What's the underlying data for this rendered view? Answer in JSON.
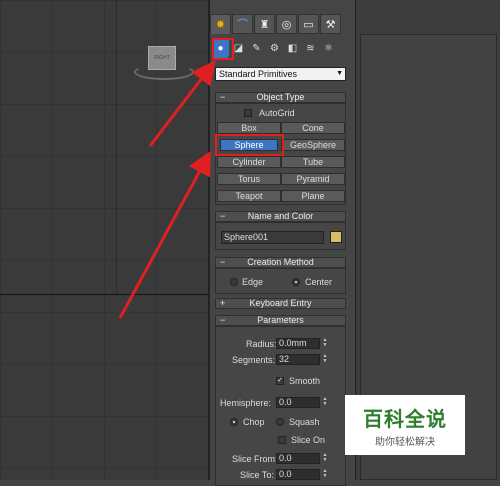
{
  "viewport": {
    "viewcube_label": "RIGHT"
  },
  "tabs": [
    {
      "icon": "create-icon",
      "glyph": "✸"
    },
    {
      "icon": "modify-icon",
      "glyph": "⌒"
    },
    {
      "icon": "hierarchy-icon",
      "glyph": "♜"
    },
    {
      "icon": "motion-icon",
      "glyph": "◎"
    },
    {
      "icon": "display-icon",
      "glyph": "▭"
    },
    {
      "icon": "utilities-icon",
      "glyph": "⚒"
    }
  ],
  "subtabs": [
    {
      "icon": "geometry-icon",
      "glyph": "●"
    },
    {
      "icon": "shapes-icon",
      "glyph": "◪"
    },
    {
      "icon": "lights-icon",
      "glyph": "✎"
    },
    {
      "icon": "cameras-icon",
      "glyph": "⚙"
    },
    {
      "icon": "helpers-icon",
      "glyph": "◧"
    },
    {
      "icon": "spacewarps-icon",
      "glyph": "≋"
    },
    {
      "icon": "systems-icon",
      "glyph": "⚛"
    }
  ],
  "category_dropdown": {
    "value": "Standard Primitives"
  },
  "object_type": {
    "title": "Object Type",
    "autogrid_label": "AutoGrid",
    "buttons": [
      "Box",
      "Cone",
      "Sphere",
      "GeoSphere",
      "Cylinder",
      "Tube",
      "Torus",
      "Pyramid",
      "Teapot",
      "Plane"
    ],
    "active": "Sphere"
  },
  "name_color": {
    "title": "Name and Color",
    "name_value": "Sphere001",
    "color": "#d8c060"
  },
  "creation_method": {
    "title": "Creation Method",
    "options": [
      "Edge",
      "Center"
    ],
    "selected": "Center"
  },
  "keyboard_entry": {
    "title": "Keyboard Entry"
  },
  "parameters": {
    "title": "Parameters",
    "radius_label": "Radius:",
    "radius_value": "0.0mm",
    "segments_label": "Segments:",
    "segments_value": "32",
    "smooth_label": "Smooth",
    "hemisphere_label": "Hemisphere:",
    "hemisphere_value": "0.0",
    "chop_label": "Chop",
    "squash_label": "Squash",
    "slice_on_label": "Slice On",
    "slice_from_label": "Slice From:",
    "slice_from_value": "0.0",
    "slice_to_label": "Slice To:",
    "slice_to_value": "0.0"
  },
  "watermark": {
    "title": "百科全说",
    "subtitle": "助你轻松解决"
  },
  "colors": {
    "highlight_red": "#e02020",
    "active_blue": "#3d74c4"
  }
}
